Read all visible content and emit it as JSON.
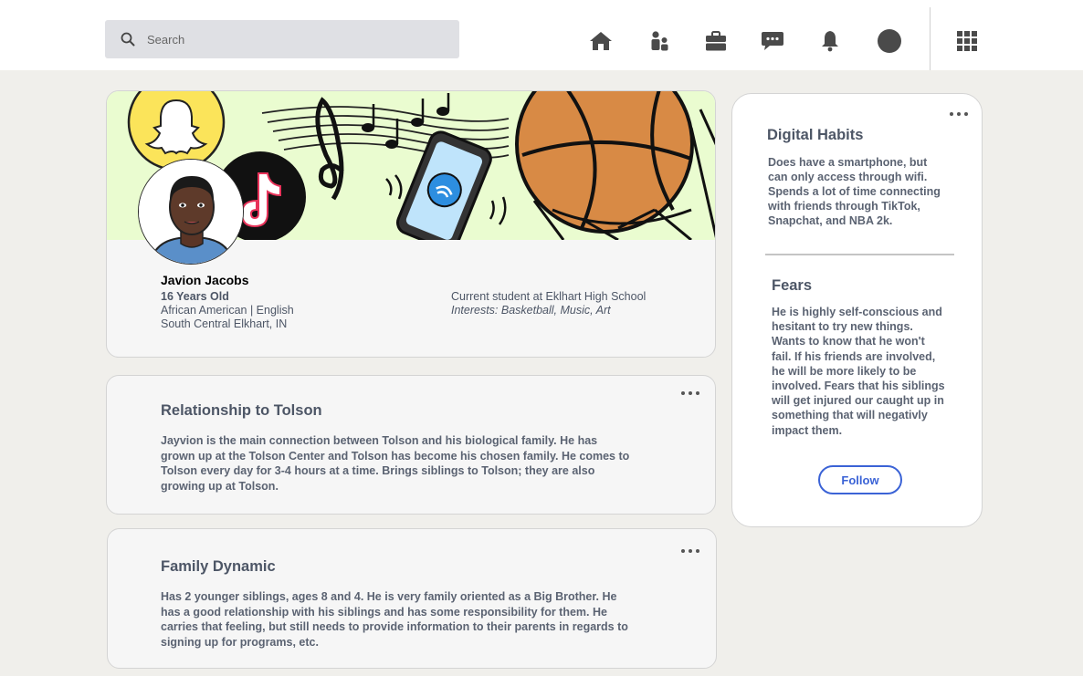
{
  "search": {
    "placeholder": "Search"
  },
  "nav": {
    "icons": [
      "home-icon",
      "people-icon",
      "briefcase-icon",
      "chat-icon",
      "bell-icon",
      "profile-icon",
      "apps-grid-icon"
    ]
  },
  "profile": {
    "name": "Javion Jacobs",
    "age": "16 Years Old",
    "ethnicity_language": "African American | English",
    "location": "South Central Elkhart, IN",
    "school": "Current student at Eklhart High School",
    "interests": "Interests: Basketball, Music, Art"
  },
  "relationship": {
    "title": "Relationship to Tolson",
    "lines": [
      "Jayvion is the main connection between Tolson and his biological family. He has",
      "grown up at the Tolson Center and Tolson has become his chosen family. He comes to",
      "Tolson every day for 3-4 hours at a time. Brings siblings to Tolson; they are also",
      "growing up at Tolson."
    ]
  },
  "family": {
    "title": "Family Dynamic",
    "lines": [
      "Has 2 younger siblings, ages 8 and 4. He is very family oriented as a Big Brother. He",
      "has a  good relationship with his siblings and has some responsibility for them. He",
      "carries that feeling, but still needs to provide information to their parents in regards to",
      "signing up for programs, etc."
    ]
  },
  "digital_habits": {
    "title": "Digital Habits",
    "lines": [
      "Does have a smartphone, but",
      "can only access through wifi.",
      "Spends a lot of time connecting",
      "with friends through TikTok,",
      "Snapchat, and NBA 2k."
    ]
  },
  "fears": {
    "title": "Fears",
    "lines": [
      "He is highly self-conscious and",
      "hesitant to try new things.",
      "Wants to know that he won't",
      "fail. If his friends are involved,",
      "he will be more likely to be",
      "involved. Fears that his siblings",
      "will get injured our caught up in",
      "something that will negativly",
      "impact them."
    ]
  },
  "follow_label": "Follow",
  "colors": {
    "accent": "#3b63d6",
    "banner_bg": "#eafcd0",
    "background": "#f0efeb"
  }
}
